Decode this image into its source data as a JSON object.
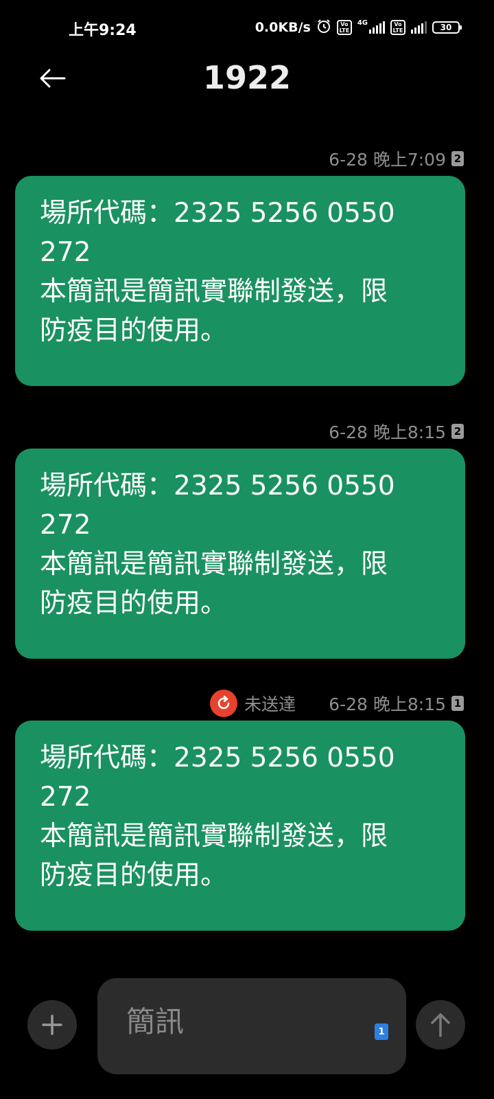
{
  "status_bar": {
    "time": "上午9:24",
    "net_speed": "0.0KB/s",
    "volte_label": "Vo LTE",
    "network_type": "4G",
    "battery": "30"
  },
  "header": {
    "title": "1922"
  },
  "messages": [
    {
      "timestamp": "6-28 晚上7:09",
      "sim": "2",
      "status": "",
      "body": "場所代碼：2325 5256 0550\n272\n本簡訊是簡訊實聯制發送，限\n防疫目的使用。"
    },
    {
      "timestamp": "6-28 晚上8:15",
      "sim": "2",
      "status": "",
      "body": "場所代碼：2325 5256 0550\n272\n本簡訊是簡訊實聯制發送，限\n防疫目的使用。"
    },
    {
      "timestamp": "6-28 晚上8:15",
      "sim": "1",
      "status": "未送達",
      "body": "場所代碼：2325 5256 0550\n272\n本簡訊是簡訊實聯制發送，限\n防疫目的使用。"
    }
  ],
  "composer": {
    "placeholder": "簡訊",
    "sim": "1"
  },
  "colors": {
    "background": "#000000",
    "bubble": "#1a9160",
    "failed": "#e8412e",
    "meta_text": "#8e8e8e",
    "input_bg": "#2c2c2c"
  },
  "icons": {
    "back": "arrow-left",
    "failed": "retry-circle",
    "add": "plus",
    "send": "arrow-up",
    "alarm": "alarm-clock"
  }
}
